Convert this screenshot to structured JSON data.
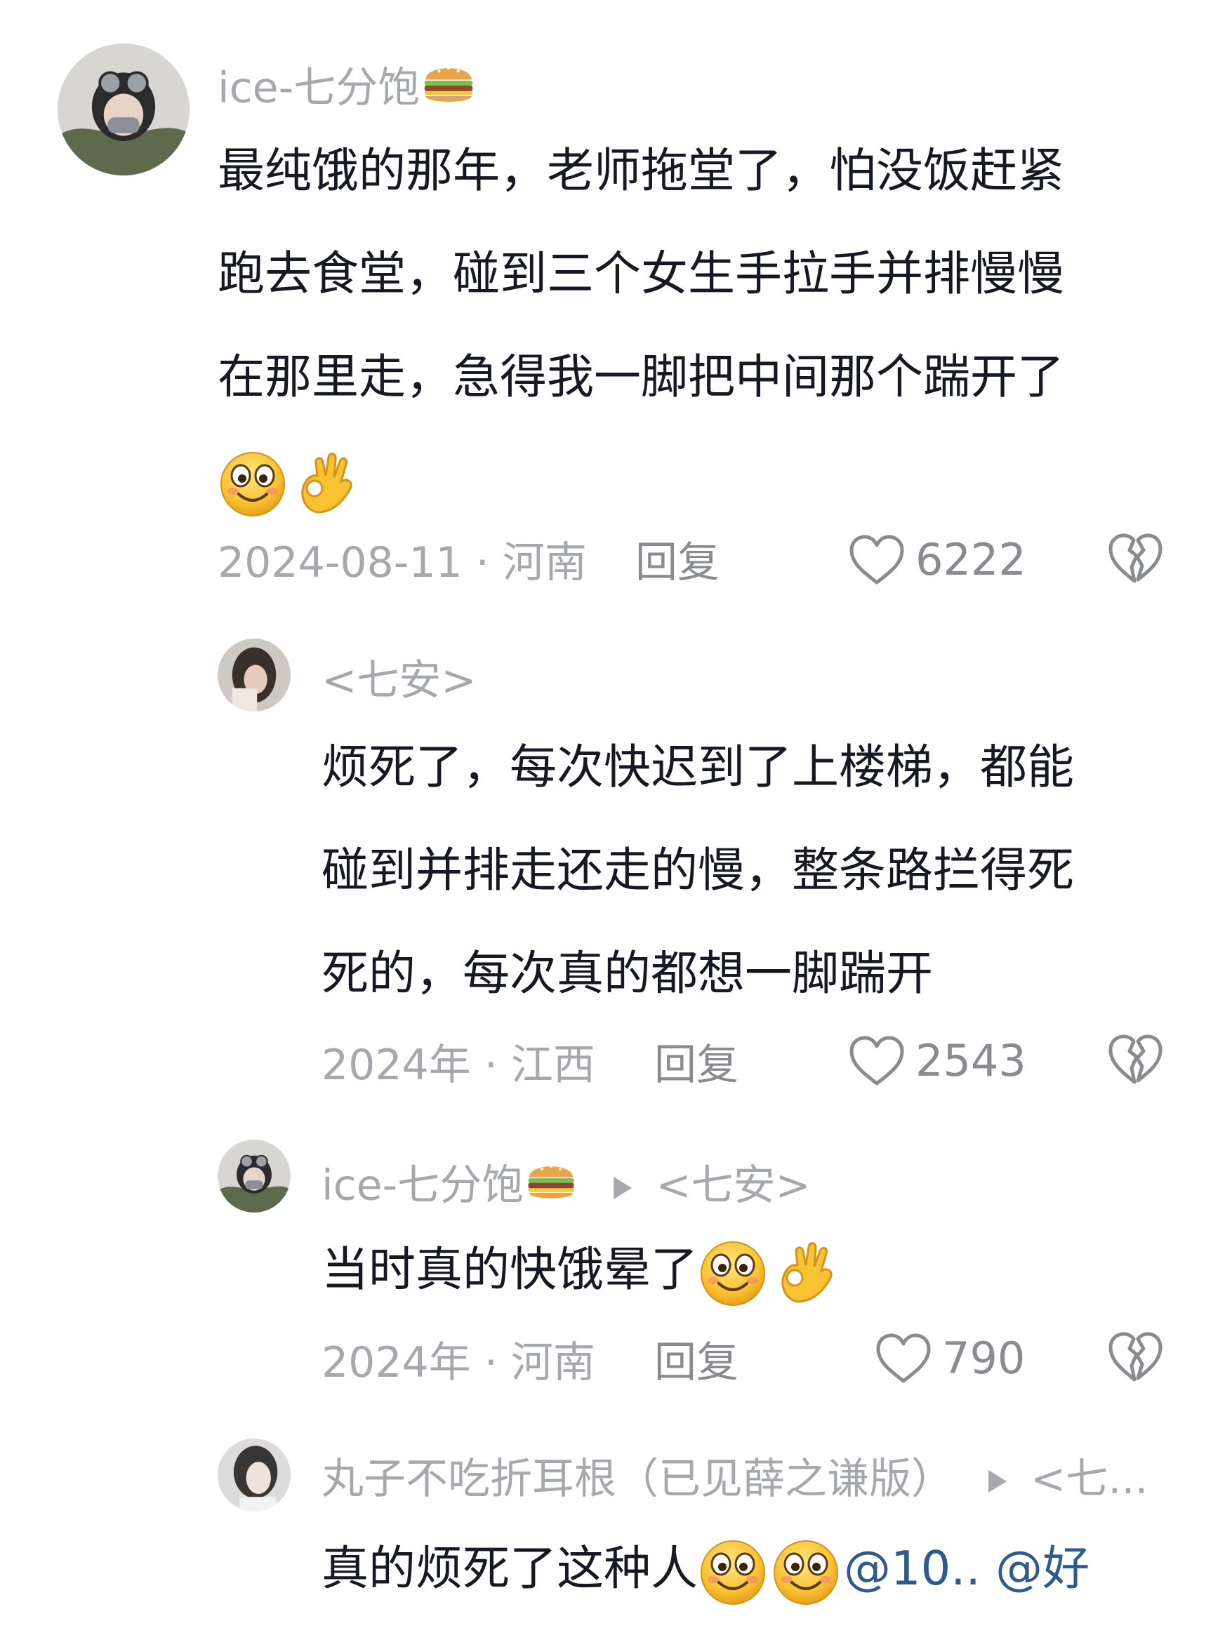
{
  "comments": [
    {
      "username": "ice-七分饱",
      "username_emoji": "burger-emoji",
      "lines": [
        "最纯饿的那年，老师拖堂了，怕没饭赶紧",
        "跑去食堂，碰到三个女生手拉手并排慢慢",
        "在那里走，急得我一脚把中间那个踹开了"
      ],
      "emojis": [
        "smile-emoji",
        "ok-hand-emoji"
      ],
      "meta": "2024-08-11 · 河南",
      "reply_label": "回复",
      "likes": "6222"
    },
    {
      "username": "<七安>",
      "lines": [
        "烦死了，每次快迟到了上楼梯，都能",
        "碰到并排走还走的慢，整条路拦得死",
        "死的，每次真的都想一脚踹开"
      ],
      "meta": "2024年 · 江西",
      "reply_label": "回复",
      "likes": "2543"
    },
    {
      "username": "ice-七分饱",
      "username_emoji": "burger-emoji",
      "reply_to": "<七安>",
      "text": "当时真的快饿晕了",
      "emojis": [
        "smile-emoji",
        "ok-hand-emoji"
      ],
      "meta": "2024年 · 河南",
      "reply_label": "回复",
      "likes": "790"
    },
    {
      "username": "丸子不吃折耳根（已见薛之谦版）",
      "reply_to": "<七...",
      "text": "真的烦死了这种人",
      "emojis": [
        "smile-emoji",
        "smile-emoji"
      ],
      "mentions": [
        "@10..",
        "@好"
      ]
    }
  ],
  "colors": {
    "muted": "#a7a8ad",
    "text": "#161823",
    "mention": "#2f5a8a"
  },
  "icons": {
    "like": "heart-outline-icon",
    "dislike": "broken-heart-icon",
    "reply_arrow": "triangle-right-icon"
  }
}
